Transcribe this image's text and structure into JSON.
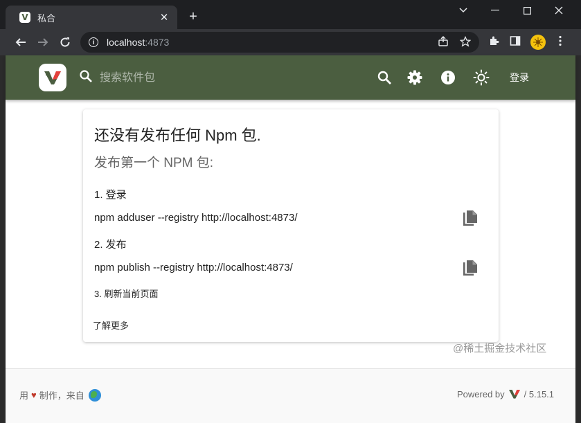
{
  "browser": {
    "tab_title": "私合",
    "tab_favicon": "V",
    "url_host": "localhost",
    "url_port": ":4873"
  },
  "appbar": {
    "search_placeholder": "搜索软件包",
    "login_label": "登录",
    "color": "#4b5e40"
  },
  "card": {
    "title": "还没有发布任何 Npm 包.",
    "subtitle": "发布第一个 NPM 包:",
    "step1_label": "1. 登录",
    "step1_cmd": "npm adduser --registry http://localhost:4873/",
    "step2_label": "2. 发布",
    "step2_cmd": "npm publish --registry http://localhost:4873/",
    "step3_label": "3. 刷新当前页面",
    "learn_more": "了解更多"
  },
  "footer": {
    "made_prefix": "用",
    "heart": "♥",
    "made_suffix": "制作，来自",
    "powered_by": "Powered by",
    "version": "/ 5.15.1"
  },
  "watermark": "@稀土掘金技术社区"
}
